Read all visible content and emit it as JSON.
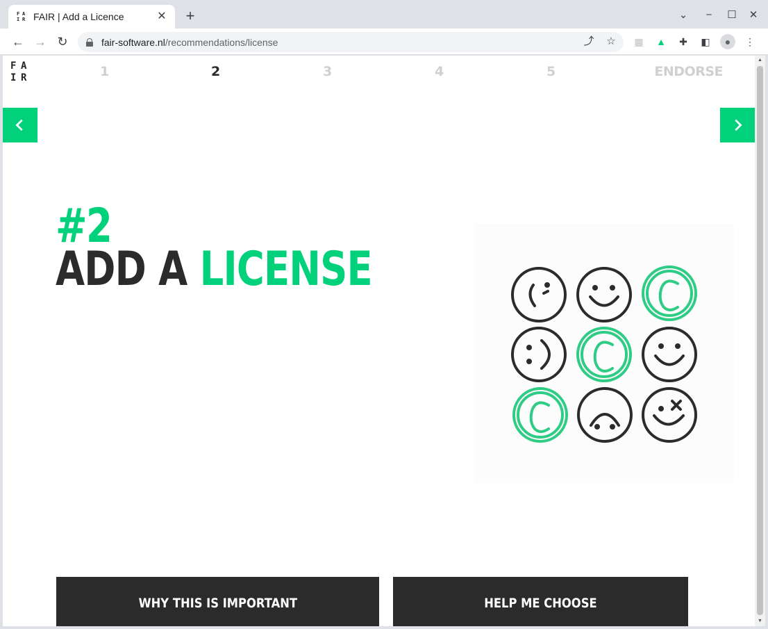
{
  "browser": {
    "tab_title": "FAIR | Add a Licence",
    "favicon_letters": [
      "F",
      "A",
      "I",
      "R"
    ],
    "url_domain": "fair-software.nl",
    "url_path": "/recommendations/license"
  },
  "site": {
    "logo_letters": [
      "F",
      "A",
      "I",
      "R"
    ],
    "steps": [
      "1",
      "2",
      "3",
      "4",
      "5"
    ],
    "active_step": "2",
    "endorse_label": "ENDORSE"
  },
  "hero": {
    "number": "#2",
    "title_prefix": "ADD A",
    "title_highlight": "LICENSE"
  },
  "buttons": {
    "why_label": "WHY THIS IS IMPORTANT",
    "help_label": "HELP ME CHOOSE"
  },
  "colors": {
    "accent": "#00d17a",
    "dark": "#2b2b2b",
    "inactive_step": "#d0d0d0"
  },
  "icons": {
    "illustration": [
      "smiley-wink-icon",
      "smiley-icon",
      "copyright-icon",
      "smiley-side-icon",
      "copyright-icon",
      "smiley-icon",
      "copyright-icon",
      "smiley-upside-down-icon",
      "smiley-x-eye-icon"
    ]
  }
}
